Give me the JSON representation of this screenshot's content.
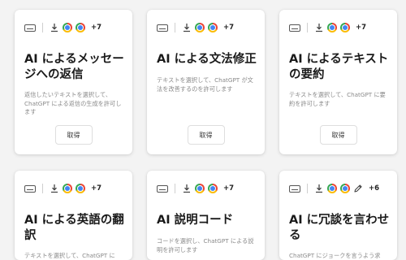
{
  "cards": [
    {
      "title": "AI によるメッセージへの返信",
      "description": "返信したいテキストを選択して、ChatGPT による返信の生成を許可します",
      "more_count": "+7",
      "button_label": "取得"
    },
    {
      "title": "AI による文法修正",
      "description": "テキストを選択して、ChatGPT が文法を改善するのを許可します",
      "more_count": "+7",
      "button_label": "取得"
    },
    {
      "title": "AI によるテキストの要約",
      "description": "テキストを選択して、ChatGPT に要約を許可します",
      "more_count": "+7",
      "button_label": "取得"
    },
    {
      "title": "AI による英語の翻訳",
      "description": "テキストを選択して、ChatGPT に",
      "more_count": "+7"
    },
    {
      "title": "AI 説明コード",
      "description": "コードを選択し、ChatGPT による説明を許可します",
      "more_count": "+7"
    },
    {
      "title": "AI に冗談を言わせる",
      "description": "ChatGPT にジョークを言うよう求",
      "more_count": "+6"
    }
  ],
  "icons": {
    "keyboard": "keyboard-icon",
    "download": "download-icon",
    "chrome": "chrome-icon",
    "pencil": "pencil-icon"
  }
}
